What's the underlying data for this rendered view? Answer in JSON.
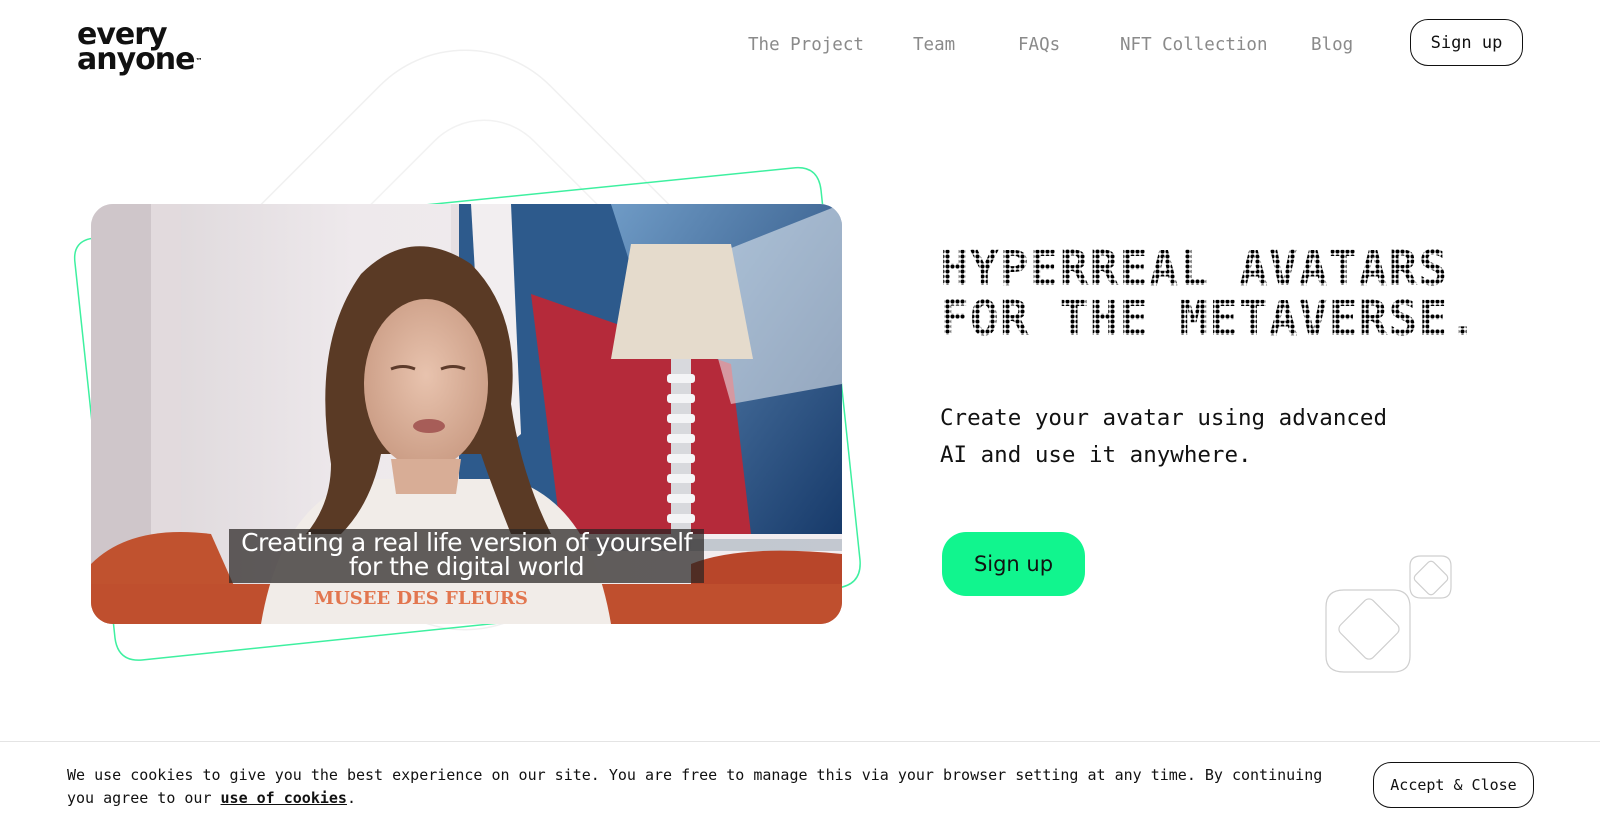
{
  "brand": {
    "logo_line1": "every",
    "logo_line2": "anyone",
    "logo_tm": "™"
  },
  "nav": {
    "items": [
      {
        "label": "The Project"
      },
      {
        "label": "Team"
      },
      {
        "label": "FAQs"
      },
      {
        "label": "NFT Collection"
      },
      {
        "label": "Blog"
      }
    ],
    "signup_label": "Sign up"
  },
  "hero": {
    "title_line1": "HYPERREAL AVATARS",
    "title_line2": "FOR THE METAVERSE.",
    "subtitle_line1": "Create your avatar using advanced",
    "subtitle_line2": "AI and use it anywhere.",
    "cta_label": "Sign up",
    "video": {
      "caption_line1": "Creating a real life version of yourself",
      "caption_line2": "for the digital world",
      "shirt_text": "MUSEE DES FLEURS"
    }
  },
  "cookie": {
    "text": "We use cookies to give you the best experience on our site. You are free to manage this via your browser setting at any time. By continuing you agree to our ",
    "link_label": "use of cookies",
    "suffix": ".",
    "accept_label": "Accept & Close"
  },
  "colors": {
    "accent_green": "#11f58e",
    "outline_green": "#3ef0a0",
    "nav_gray": "#8a8a8a"
  }
}
